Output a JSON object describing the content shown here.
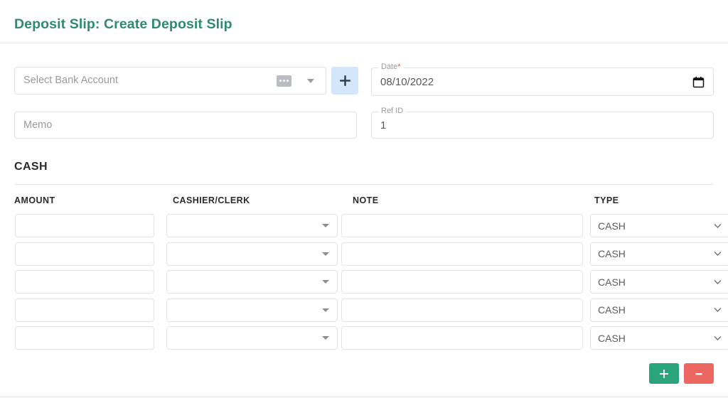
{
  "header": {
    "title": "Deposit Slip: Create Deposit Slip",
    "title_color": "#2e8b70"
  },
  "form": {
    "bank_account": {
      "placeholder": "Select Bank Account",
      "value": "",
      "ellipsis_icon": "ellipsis-icon",
      "dropdown_icon": "caret-down-icon",
      "add_button_label": "+",
      "add_button_color": "#d4e7fa"
    },
    "date": {
      "label": "Date",
      "required_mark": "*",
      "value": "08/10/2022",
      "calendar_icon": "calendar-icon"
    },
    "memo": {
      "placeholder": "Memo",
      "value": ""
    },
    "ref_id": {
      "label": "Ref ID",
      "value": "1"
    }
  },
  "cash_section": {
    "title": "CASH",
    "columns": [
      "AMOUNT",
      "CASHIER/CLERK",
      "NOTE",
      "TYPE"
    ],
    "rows": [
      {
        "amount": "",
        "cashier": "",
        "note": "",
        "type": "CASH"
      },
      {
        "amount": "",
        "cashier": "",
        "note": "",
        "type": "CASH"
      },
      {
        "amount": "",
        "cashier": "",
        "note": "",
        "type": "CASH"
      },
      {
        "amount": "",
        "cashier": "",
        "note": "",
        "type": "CASH"
      },
      {
        "amount": "",
        "cashier": "",
        "note": "",
        "type": "CASH"
      }
    ],
    "type_options": [
      "CASH"
    ]
  },
  "footer": {
    "add_row_label": "+",
    "remove_row_label": "−",
    "add_color": "#2aa47a",
    "remove_color": "#ec6761"
  }
}
